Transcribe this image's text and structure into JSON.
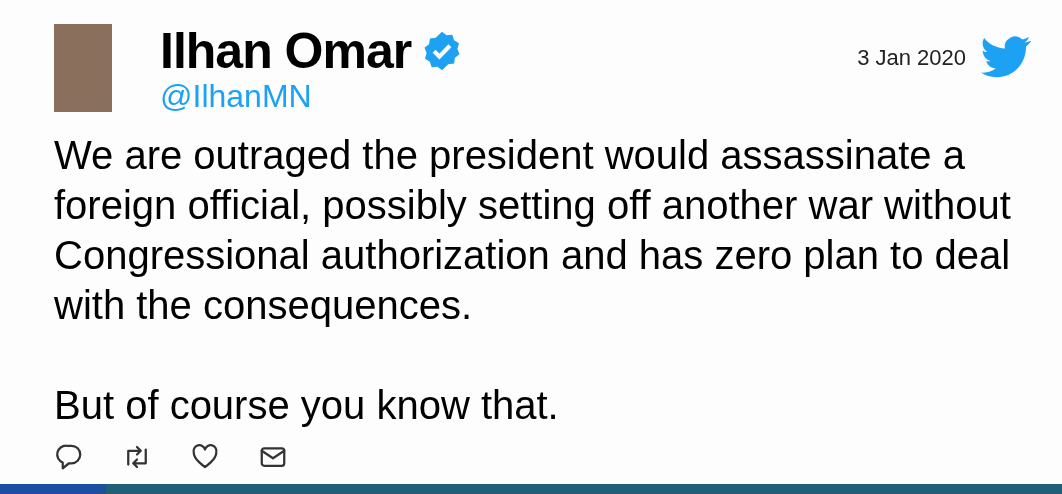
{
  "tweet": {
    "author": {
      "name": "Ilhan Omar",
      "verified": true,
      "handle": "@IlhanMN"
    },
    "date": "3 Jan 2020",
    "paragraphs": [
      "We are outraged the president would assassinate a foreign official, possibly setting off another war without Congressional authorization and has zero plan to deal with the consequences.",
      "But of course you know that."
    ],
    "actions": [
      {
        "kind": "reply"
      },
      {
        "kind": "retweet"
      },
      {
        "kind": "like"
      },
      {
        "kind": "message"
      }
    ]
  }
}
